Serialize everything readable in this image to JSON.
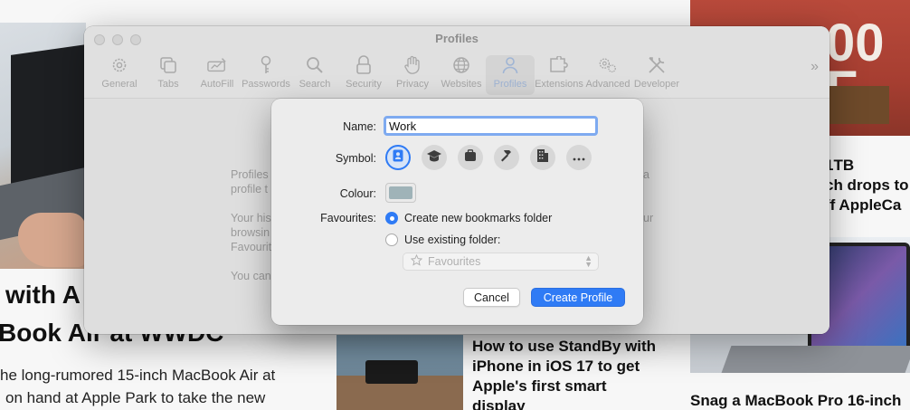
{
  "background": {
    "img_right_top_text": "00\nF",
    "headline_left_1": "with A",
    "headline_left_2": "Book Air at WWDC",
    "body_left_1": "he long-rumored 15-inch MacBook Air at",
    "body_left_2": "on hand at Apple Park to take the new",
    "story_center": [
      "How to use StandBy with",
      "iPhone in iOS 17 to get",
      "Apple's first smart",
      "display"
    ],
    "story_right_1": [
      "1TB",
      "ch drops to",
      "ff AppleCa"
    ],
    "story_right_2": "Snag a MacBook Pro 16-inch"
  },
  "window": {
    "title": "Profiles",
    "toolbar": [
      {
        "label": "General",
        "icon": "gear-icon"
      },
      {
        "label": "Tabs",
        "icon": "tabs-icon"
      },
      {
        "label": "AutoFill",
        "icon": "autofill-icon"
      },
      {
        "label": "Passwords",
        "icon": "key-icon"
      },
      {
        "label": "Search",
        "icon": "search-icon"
      },
      {
        "label": "Security",
        "icon": "lock-icon"
      },
      {
        "label": "Privacy",
        "icon": "hand-icon"
      },
      {
        "label": "Websites",
        "icon": "globe-icon"
      },
      {
        "label": "Profiles",
        "icon": "person-icon"
      },
      {
        "label": "Extensions",
        "icon": "puzzle-icon"
      },
      {
        "label": "Advanced",
        "icon": "gears-icon"
      },
      {
        "label": "Developer",
        "icon": "tools-icon"
      }
    ],
    "overflow": "»",
    "ghost_text": [
      "Profiles",
      "profile t",
      "Your his",
      "browsin",
      "Favourit",
      "You can",
      "a",
      "ur"
    ]
  },
  "sheet": {
    "name_label": "Name:",
    "name_value": "Work",
    "symbol_label": "Symbol:",
    "symbols": [
      "person-badge-icon",
      "graduation-cap-icon",
      "briefcase-icon",
      "hammer-icon",
      "building-icon",
      "more-icon"
    ],
    "colour_label": "Colour:",
    "colour_value": "#9fb3b8",
    "favourites_label": "Favourites:",
    "option_new": "Create new bookmarks folder",
    "option_existing": "Use existing folder:",
    "selected_option": "new",
    "folder_value": "Favourites",
    "cancel": "Cancel",
    "create": "Create Profile"
  },
  "colors": {
    "accent": "#2f7bf5"
  }
}
